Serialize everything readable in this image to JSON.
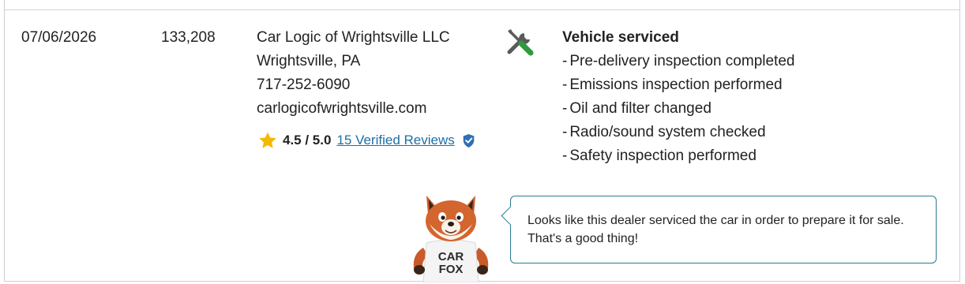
{
  "record": {
    "date": "07/06/2026",
    "mileage": "133,208",
    "dealer": {
      "name": "Car Logic of Wrightsville LLC",
      "location": "Wrightsville, PA",
      "phone": "717-252-6090",
      "website": "carlogicofwrightsville.com",
      "rating_text": "4.5 / 5.0",
      "rating_value": 4.5,
      "reviews_link": "15 Verified Reviews"
    },
    "comments": {
      "heading": "Vehicle serviced",
      "items": [
        "Pre-delivery inspection completed",
        "Emissions inspection performed",
        "Oil and filter changed",
        "Radio/sound system checked",
        "Safety inspection performed"
      ]
    },
    "icons": {
      "service": "wrench-screwdriver-icon",
      "rating": "star-icon",
      "verified": "shield-check-icon",
      "mascot": "carfox-mascot"
    },
    "mascot_shirt": {
      "line1": "CAR",
      "line2": "FOX"
    },
    "tip": {
      "text": "Looks like this dealer serviced the car in order to prepare it for sale. That's a good thing!"
    },
    "colors": {
      "link": "#1d6fa5",
      "bubble_border": "#2a7a94",
      "star": "#f5b800",
      "tool_green": "#2e9a3e",
      "shield": "#2f6fb7"
    }
  }
}
